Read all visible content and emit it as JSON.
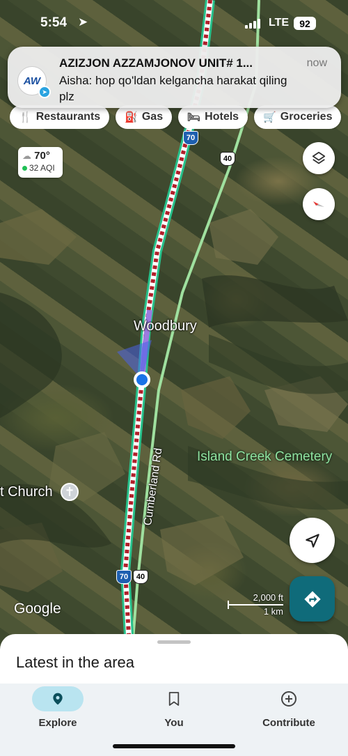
{
  "status_bar": {
    "time": "5:54",
    "network": "LTE",
    "battery": "92"
  },
  "notification": {
    "title": "AZIZJON AZZAMJONOV UNIT# 1...",
    "time": "now",
    "body": "Aisha: hop qo'ldan kelgancha harakat qiling plz",
    "app_icon": "telegram-icon"
  },
  "chips": [
    {
      "label": "Restaurants",
      "icon": "restaurant-icon"
    },
    {
      "label": "Gas",
      "icon": "gas-station-icon"
    },
    {
      "label": "Hotels",
      "icon": "hotel-icon"
    },
    {
      "label": "Groceries",
      "icon": "cart-icon"
    }
  ],
  "weather": {
    "temp": "70°",
    "aqi": "32 AQI"
  },
  "map": {
    "town": "Woodbury",
    "cemetery": "Island Creek Cemetery",
    "church": "t Church",
    "road": "Cumberland Rd",
    "shields": {
      "interstate": "70",
      "us_route": "40"
    },
    "scale_ft": "2,000 ft",
    "scale_km": "1 km",
    "attribution": "Google",
    "route_color": "#2ecc71"
  },
  "sheet": {
    "title": "Latest in the area"
  },
  "nav": {
    "explore": "Explore",
    "you": "You",
    "contribute": "Contribute"
  }
}
